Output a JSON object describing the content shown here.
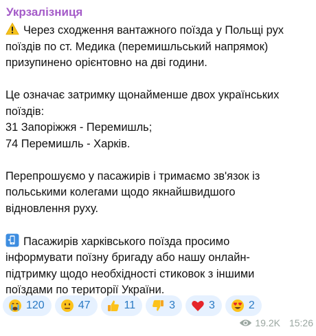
{
  "channel": {
    "name": "Укрзалізниця"
  },
  "message": {
    "paragraph1": {
      "icon": "warning-icon",
      "lines": [
        "Через сходження вантажного поїзда у Польщі рух",
        "поїздів по ст. Медика (перемишльський напрямок)",
        "призупинено орієнтовно на дві години."
      ]
    },
    "paragraph2": {
      "lines": [
        "Це означає затримку щонайменше двох українських",
        "поїздів:",
        "31 Запоріжжя - Перемишль;",
        "74 Перемишль - Харків."
      ]
    },
    "paragraph3": {
      "lines": [
        "Перепрошуємо у пасажирів і тримаємо зв'язок із",
        "польськими колегами щодо якнайшвидшого",
        "відновлення руху."
      ]
    },
    "paragraph4": {
      "icon": "phone-icon",
      "lines": [
        "Пасажирів харківського поїзда просимо",
        "інформувати поїзну бригаду або нашу онлайн-",
        "підтримку щодо необхідності стиковок з іншими",
        "поїздами по території України."
      ]
    }
  },
  "reactions": [
    {
      "icon": "crying-face-icon",
      "count": "120"
    },
    {
      "icon": "neutral-face-icon",
      "count": "47"
    },
    {
      "icon": "thumbs-up-icon",
      "count": "11"
    },
    {
      "icon": "thumbs-down-icon",
      "count": "3"
    },
    {
      "icon": "red-heart-icon",
      "count": "3"
    },
    {
      "icon": "heart-eyes-icon",
      "count": "2"
    }
  ],
  "meta": {
    "views": "19.2K",
    "time": "15:26"
  },
  "colors": {
    "channel_name": "#a45bc8",
    "reaction_bg": "#e6f1ff",
    "reaction_count": "#2a7ac4",
    "meta_text": "#9aa6a0"
  }
}
